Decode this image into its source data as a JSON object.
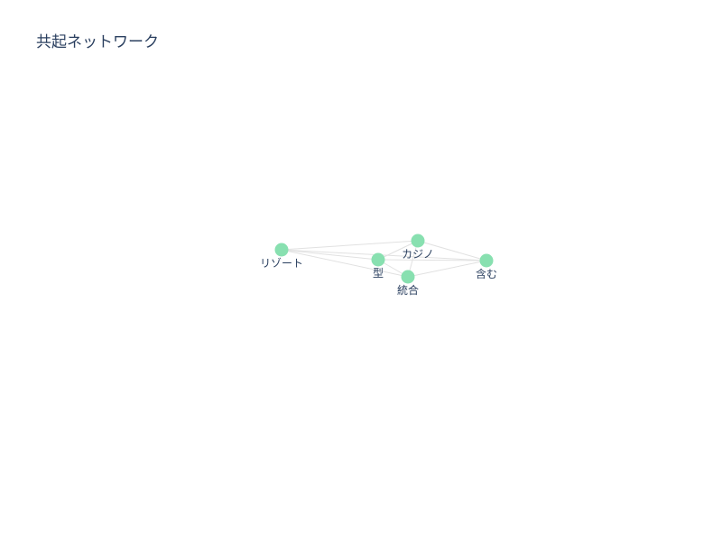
{
  "title": "共起ネットワーク",
  "chart_data": {
    "type": "network",
    "title": "共起ネットワーク",
    "node_color": "#88e0b0",
    "edge_color": "#e1e1e1",
    "nodes": [
      {
        "id": "resort",
        "label": "リゾート"
      },
      {
        "id": "casino",
        "label": "カジノ"
      },
      {
        "id": "gata",
        "label": "型"
      },
      {
        "id": "tougou",
        "label": "統合"
      },
      {
        "id": "fukumu",
        "label": "含む"
      }
    ],
    "edges": [
      [
        "resort",
        "casino"
      ],
      [
        "resort",
        "gata"
      ],
      [
        "resort",
        "tougou"
      ],
      [
        "resort",
        "fukumu"
      ],
      [
        "casino",
        "gata"
      ],
      [
        "casino",
        "tougou"
      ],
      [
        "casino",
        "fukumu"
      ],
      [
        "gata",
        "tougou"
      ],
      [
        "gata",
        "fukumu"
      ],
      [
        "tougou",
        "fukumu"
      ]
    ]
  }
}
